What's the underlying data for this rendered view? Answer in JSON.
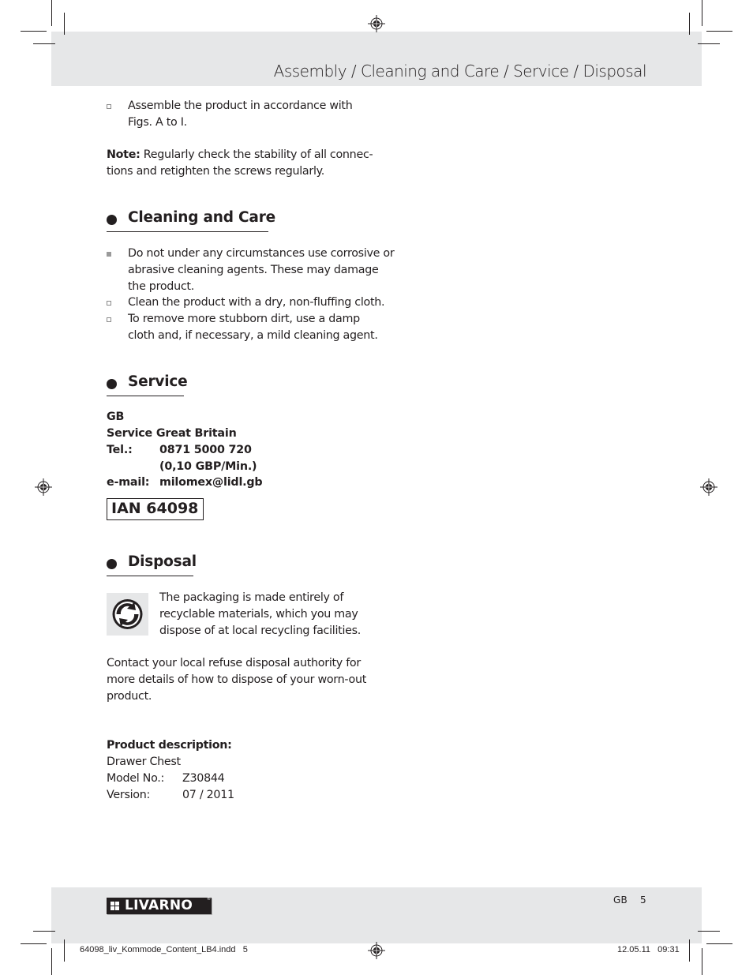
{
  "header": {
    "title": "Assembly / Cleaning and Care / Service / Disposal"
  },
  "assembly": {
    "bullets": [
      {
        "marker": "hollow",
        "lines": [
          "Assemble the product in accordance with",
          "Figs. A to I."
        ]
      }
    ],
    "note_label": "Note:",
    "note_lines": [
      "Regularly check the stability of all connec-",
      "tions and retighten the screws regularly."
    ]
  },
  "cleaning": {
    "heading": "Cleaning and Care",
    "bullets": [
      {
        "marker": "filled",
        "lines": [
          "Do not under any circumstances use corrosive or",
          "abrasive cleaning agents. These may damage",
          "the product."
        ]
      },
      {
        "marker": "hollow",
        "lines": [
          "Clean the product with a dry, non-fluffing cloth."
        ]
      },
      {
        "marker": "hollow",
        "lines": [
          "To remove more stubborn dirt, use a damp",
          "cloth and, if necessary, a mild cleaning agent."
        ]
      }
    ]
  },
  "service": {
    "heading": "Service",
    "country": "GB",
    "name": "Service Great Britain",
    "tel_label": "Tel.:",
    "tel_value": "0871 5000 720",
    "tel_rate": "(0,10 GBP/Min.)",
    "email_label": "e-mail:",
    "email_value": "milomex@lidl.gb",
    "ian": "IAN 64098"
  },
  "disposal": {
    "heading": "Disposal",
    "icon": "green-dot-recycling-icon",
    "packaging_lines": [
      "The packaging is made entirely of",
      "recyclable materials, which you may",
      "dispose of at local recycling facilities."
    ],
    "contact_lines": [
      "Contact your local refuse disposal authority for",
      "more details of how to dispose of your worn-out",
      "product."
    ]
  },
  "product": {
    "label": "Product description:",
    "name": "Drawer Chest",
    "model_label": "Model No.:",
    "model_value": "Z30844",
    "version_label": "Version:",
    "version_value": "07 / 2011"
  },
  "footer": {
    "brand": "LIVARNO",
    "brand_reg": "®",
    "language": "GB",
    "page_number": "5"
  },
  "slug": {
    "file": "64098_liv_Kommode_Content_LB4.indd   5",
    "datetime": "12.05.11   09:31"
  }
}
